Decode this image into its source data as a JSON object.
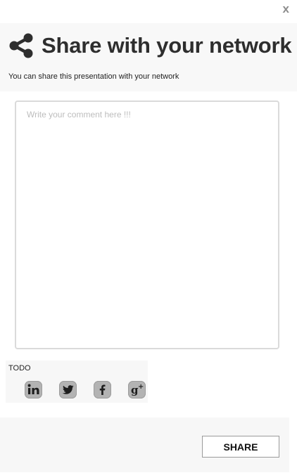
{
  "dialog": {
    "close_label": "x",
    "title": "Share with your network",
    "subtitle": "You can share this presentation with your network"
  },
  "comment": {
    "placeholder": "Write your comment here !!!",
    "value": ""
  },
  "social": {
    "label": "TODO",
    "networks": [
      {
        "name": "linkedin",
        "icon": "linkedin-icon"
      },
      {
        "name": "twitter",
        "icon": "twitter-icon"
      },
      {
        "name": "facebook",
        "icon": "facebook-icon"
      },
      {
        "name": "google-plus",
        "icon": "google-plus-icon"
      }
    ]
  },
  "footer": {
    "share_label": "SHARE"
  },
  "colors": {
    "header_bg": "#f8f8f8",
    "title": "#2e2e2e",
    "icon_bg": "#b3b3b3",
    "close": "#8c8c8c"
  }
}
